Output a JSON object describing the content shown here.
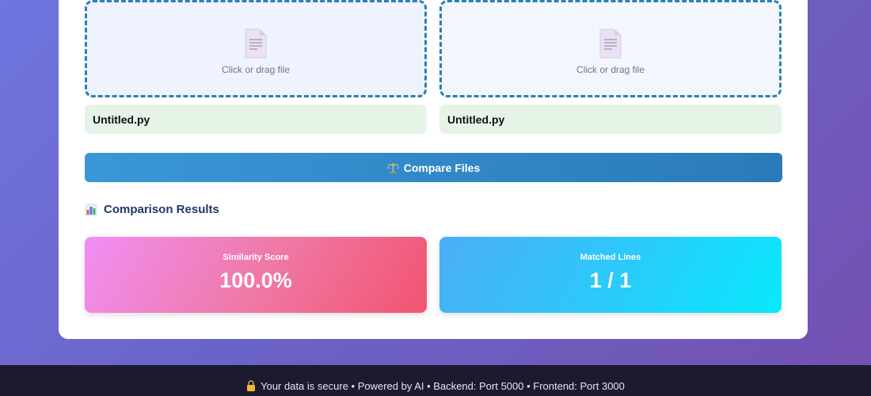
{
  "upload": {
    "left": {
      "hint": "Click or drag file",
      "filename": "Untitled.py"
    },
    "right": {
      "hint": "Click or drag file",
      "filename": "Untitled.py"
    }
  },
  "compare_button": {
    "icon": "scale-icon",
    "label": "Compare Files"
  },
  "results": {
    "icon": "bar-chart-icon",
    "title": "Comparison Results",
    "similarity": {
      "label": "Similarity Score",
      "value": "100.0%"
    },
    "matched": {
      "label": "Matched Lines",
      "value": "1 / 1"
    }
  },
  "footer": {
    "icon": "lock-icon",
    "text": "Your data is secure • Powered by AI • Backend: Port 5000 • Frontend: Port 3000"
  },
  "colors": {
    "accent": "#2c7fb8",
    "file_chip": "#e6f4e7",
    "results_title": "#1e3a6a",
    "footer_bg": "#1b1a2e"
  }
}
